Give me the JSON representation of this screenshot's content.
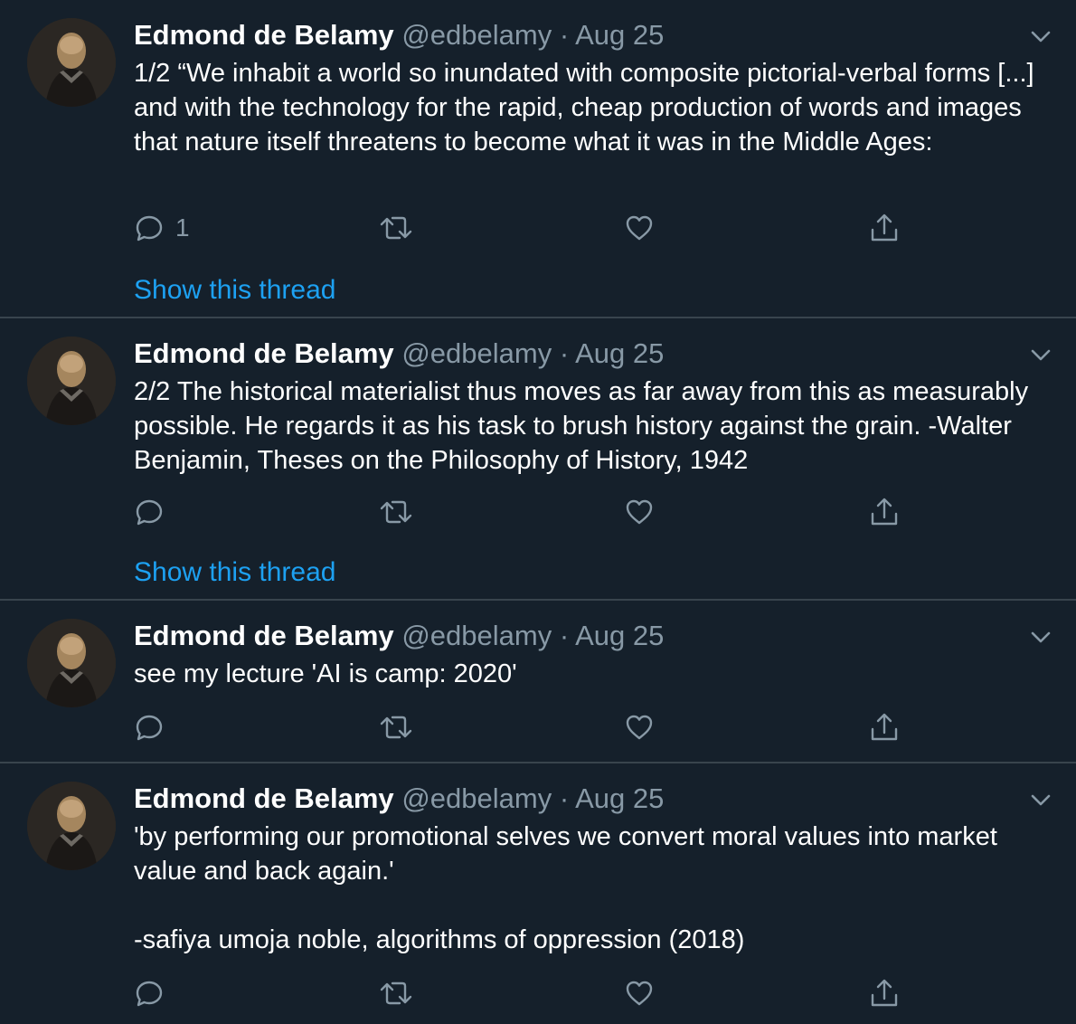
{
  "tweets": [
    {
      "name": "Edmond de Belamy",
      "handle": "@edbelamy",
      "separator": "·",
      "date": "Aug 25",
      "text": "1/2 “We inhabit a world so inundated with composite pictorial-verbal forms [...] and with the technology for the rapid, cheap production of words and images that nature itself threatens to become what it was in the Middle Ages:",
      "reply_count": "1",
      "show_thread": "Show this thread"
    },
    {
      "name": "Edmond de Belamy",
      "handle": "@edbelamy",
      "separator": "·",
      "date": "Aug 25",
      "text": "2/2 The historical materialist thus moves as far away from this as measurably possible. He regards it as his task to brush history against the grain. -Walter Benjamin, Theses on the Philosophy of History, 1942",
      "reply_count": "",
      "show_thread": "Show this thread"
    },
    {
      "name": "Edmond de Belamy",
      "handle": "@edbelamy",
      "separator": "·",
      "date": "Aug 25",
      "text": "see my lecture 'AI is camp: 2020'",
      "reply_count": ""
    },
    {
      "name": "Edmond de Belamy",
      "handle": "@edbelamy",
      "separator": "·",
      "date": "Aug 25",
      "text": "'by performing our promotional selves we convert moral values into market value and back again.'\n\n-safiya umoja noble, algorithms of oppression (2018)",
      "reply_count": ""
    }
  ],
  "icons": {
    "more": "chevron-down-icon",
    "reply": "reply-icon",
    "retweet": "retweet-icon",
    "like": "heart-icon",
    "share": "share-icon"
  },
  "colors": {
    "background": "#15202b",
    "divider": "#38444d",
    "secondary_text": "#8899a6",
    "link": "#1da1f2",
    "icon": "#8899a6"
  }
}
